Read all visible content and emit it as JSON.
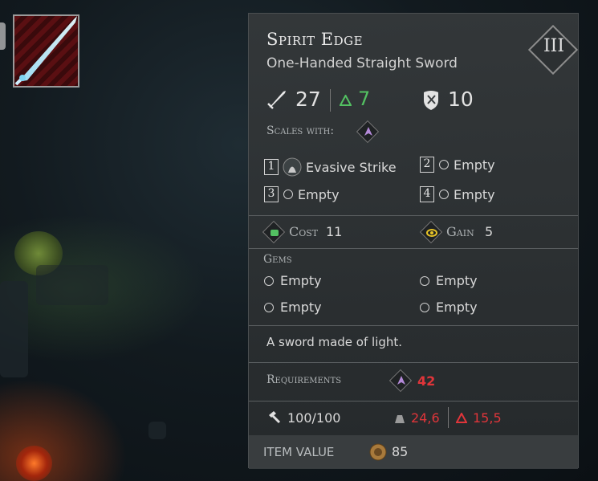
{
  "item": {
    "name": "Spirit Edge",
    "type": "One-Handed Straight Sword",
    "tier": "III"
  },
  "stats": {
    "damage": "27",
    "damage_bonus": "7",
    "stagger": "10"
  },
  "scales_with_label": "Scales with:",
  "slots": [
    {
      "num": "1",
      "label": "Evasive Strike"
    },
    {
      "num": "2",
      "label": "Empty"
    },
    {
      "num": "3",
      "label": "Empty"
    },
    {
      "num": "4",
      "label": "Empty"
    }
  ],
  "cost": {
    "label": "Cost",
    "value": "11"
  },
  "gain": {
    "label": "Gain",
    "value": "5"
  },
  "gems_label": "Gems",
  "gems": [
    "Empty",
    "Empty",
    "Empty",
    "Empty"
  ],
  "description": "A sword made of light.",
  "requirements": {
    "label": "Requirements",
    "value": "42"
  },
  "durability": "100/100",
  "weight": "24,6",
  "encumbrance": "15,5",
  "item_value": {
    "label": "ITEM VALUE",
    "value": "85"
  },
  "colors": {
    "green": "#53c162",
    "red": "#e0353a",
    "scaling": "#b48ad8",
    "gain": "#e7c327"
  }
}
